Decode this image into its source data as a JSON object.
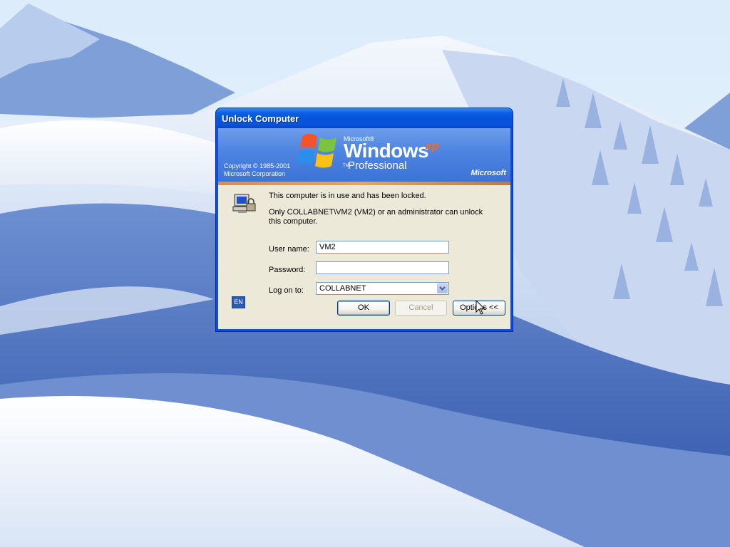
{
  "dialog": {
    "title": "Unlock Computer",
    "banner": {
      "copyright_line1": "Copyright © 1985-2001",
      "copyright_line2": "Microsoft Corporation",
      "microsoft_small": "Microsoft®",
      "windows": "Windows",
      "xp": "xp",
      "tm": "TM",
      "edition": "Professional",
      "microsoft_logo": "Microsoft"
    },
    "message_line1": "This computer is in use and has been locked.",
    "message_line2": "Only COLLABNET\\VM2 (VM2) or an administrator can unlock this computer.",
    "fields": {
      "username_label": "User name:",
      "username_value": "VM2",
      "password_label": "Password:",
      "password_value": "",
      "logon_label": "Log on to:",
      "logon_value": "COLLABNET"
    },
    "language_indicator": "EN",
    "buttons": {
      "ok": "OK",
      "cancel": "Cancel",
      "options": "Options <<"
    }
  },
  "colors": {
    "titlebar": "#0553d8",
    "dialog_body": "#ece9d8",
    "xp_accent": "#f46b1f"
  }
}
